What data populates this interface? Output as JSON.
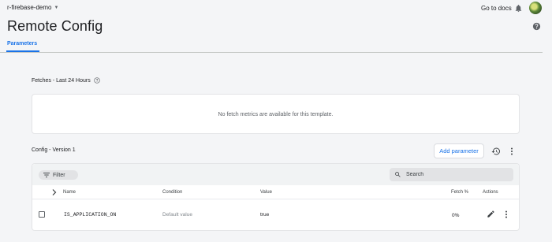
{
  "header": {
    "project": "r-firebase-demo",
    "docs_link": "Go to docs",
    "title": "Remote Config"
  },
  "tabs": [
    {
      "label": "Parameters",
      "active": true
    }
  ],
  "fetches": {
    "label": "Fetches - Last 24 Hours",
    "empty_message": "No fetch metrics are available for this template."
  },
  "config": {
    "version_label": "Config - Version 1",
    "add_parameter_label": "Add parameter"
  },
  "table": {
    "filter_label": "Filter",
    "search_placeholder": "Search",
    "columns": {
      "name": "Name",
      "condition": "Condition",
      "value": "Value",
      "fetch": "Fetch %",
      "actions": "Actions"
    },
    "rows": [
      {
        "name": "IS_APPLICATION_ON",
        "condition": "Default value",
        "value": "true",
        "fetch": "0%"
      }
    ]
  },
  "colors": {
    "accent": "#1a73e8",
    "background": "#f4f5f7",
    "card": "#ffffff"
  },
  "icons": {
    "bell": "bell-icon",
    "help": "help-circle-icon",
    "history": "history-icon",
    "more": "more-vert-icon",
    "edit": "pencil-icon",
    "search": "search-icon",
    "filter": "filter-list-icon"
  }
}
